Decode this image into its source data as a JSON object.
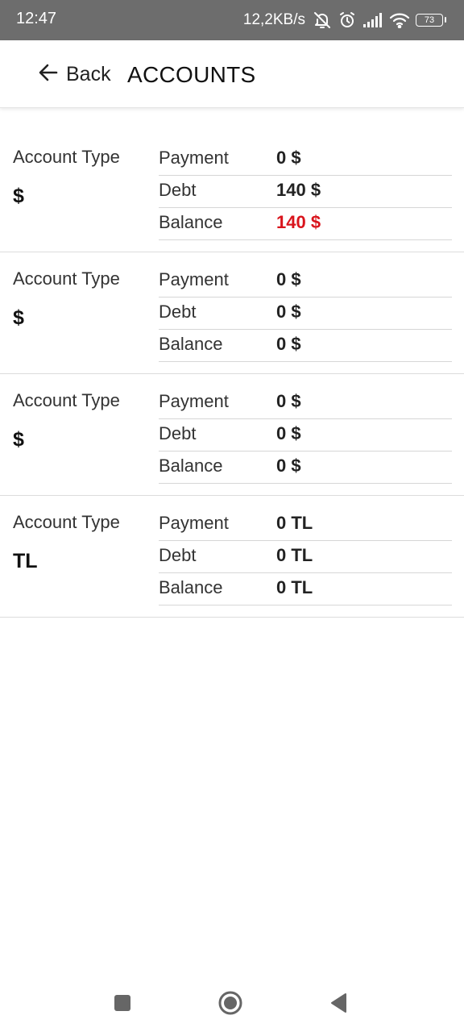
{
  "status_bar": {
    "time": "12:47",
    "network_speed": "12,2KB/s",
    "battery_level": "73",
    "icons": [
      "bell-off-icon",
      "alarm-icon",
      "signal-icon",
      "wifi-icon",
      "battery-icon"
    ]
  },
  "app_bar": {
    "back_label": "Back",
    "title": "ACCOUNTS"
  },
  "accounts": [
    {
      "type_label": "Account Type",
      "currency": "$",
      "rows": [
        {
          "label": "Payment",
          "value": "0 $"
        },
        {
          "label": "Debt",
          "value": "140 $"
        },
        {
          "label": "Balance",
          "value": "140 $",
          "highlight": true
        }
      ]
    },
    {
      "type_label": "Account Type",
      "currency": "$",
      "rows": [
        {
          "label": "Payment",
          "value": "0 $"
        },
        {
          "label": "Debt",
          "value": "0 $"
        },
        {
          "label": "Balance",
          "value": "0 $"
        }
      ]
    },
    {
      "type_label": "Account Type",
      "currency": "$",
      "rows": [
        {
          "label": "Payment",
          "value": "0 $"
        },
        {
          "label": "Debt",
          "value": "0 $"
        },
        {
          "label": "Balance",
          "value": "0 $"
        }
      ]
    },
    {
      "type_label": "Account Type",
      "currency": "TL",
      "rows": [
        {
          "label": "Payment",
          "value": "0 TL"
        },
        {
          "label": "Debt",
          "value": "0 TL"
        },
        {
          "label": "Balance",
          "value": "0 TL"
        }
      ]
    }
  ],
  "colors": {
    "status_bar_bg": "#6d6d6d",
    "negative_balance": "#d9141c",
    "divider": "#d6d6d6"
  },
  "nav_bar": {
    "icons": [
      "recents-square-icon",
      "home-circle-icon",
      "back-triangle-icon"
    ]
  }
}
